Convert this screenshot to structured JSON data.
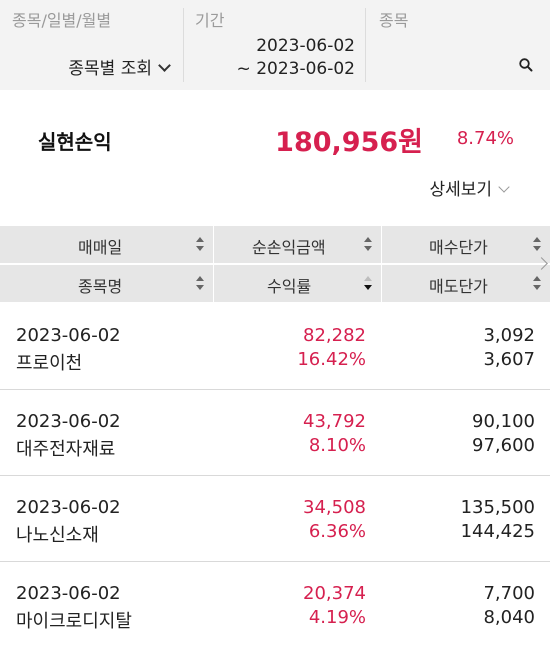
{
  "filters": {
    "stock_type": {
      "label": "종목/일별/월별",
      "value": "종목별 조회"
    },
    "period": {
      "label": "기간",
      "start": "2023-06-02",
      "end": "~ 2023-06-02"
    },
    "stock": {
      "label": "종목",
      "icon": "search-icon"
    }
  },
  "summary": {
    "label": "실현손익",
    "amount": "180,956원",
    "rate": "8.74%",
    "detail_label": "상세보기",
    "accent_color": "#d6204f"
  },
  "columns": {
    "row1": [
      "매매일",
      "순손익금액",
      "매수단가"
    ],
    "row2": [
      "종목명",
      "수익률",
      "매도단가"
    ],
    "active_sort": "수익률 descending"
  },
  "rows": [
    {
      "date": "2023-06-02",
      "name": "프로이천",
      "profit": "82,282",
      "rate": "16.42%",
      "buy_price": "3,092",
      "sell_price": "3,607"
    },
    {
      "date": "2023-06-02",
      "name": "대주전자재료",
      "profit": "43,792",
      "rate": "8.10%",
      "buy_price": "90,100",
      "sell_price": "97,600"
    },
    {
      "date": "2023-06-02",
      "name": "나노신소재",
      "profit": "34,508",
      "rate": "6.36%",
      "buy_price": "135,500",
      "sell_price": "144,425"
    },
    {
      "date": "2023-06-02",
      "name": "마이크로디지탈",
      "profit": "20,374",
      "rate": "4.19%",
      "buy_price": "7,700",
      "sell_price": "8,040"
    }
  ]
}
